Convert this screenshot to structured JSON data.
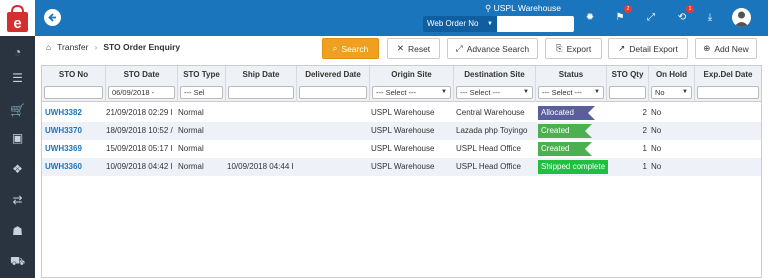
{
  "topbar": {
    "warehouse": "USPL Warehouse",
    "search_mode": "Web Order No",
    "flag_badge": "2",
    "sync_badge": "1"
  },
  "breadcrumb": {
    "parent": "Transfer",
    "current": "STO Order Enquiry"
  },
  "toolbar": {
    "search": "Search",
    "reset": "Reset",
    "advance_search": "Advance Search",
    "export": "Export",
    "detail_export": "Detail Export",
    "add_new": "Add New"
  },
  "columns": [
    "STO No",
    "STO Date",
    "STO Type",
    "Ship Date",
    "Delivered Date",
    "Origin Site",
    "Destination Site",
    "Status",
    "STO Qty",
    "On Hold",
    "Exp.Del Date"
  ],
  "filters": {
    "sto_date": "06/09/2018 -",
    "sto_type": "--- Sel",
    "origin_site": "--- Select ---",
    "destination_site": "--- Select ---",
    "status": "--- Select ---",
    "on_hold": "No"
  },
  "rows": [
    {
      "sto_no": "UWH3382",
      "sto_date": "21/09/2018 02:29 I",
      "sto_type": "Normal",
      "ship_date": "",
      "delivered_date": "",
      "origin": "USPL Warehouse",
      "destination": "Central Warehouse",
      "status": "Allocated",
      "status_color": "#5b5e9c",
      "qty": "2",
      "on_hold": "No"
    },
    {
      "sto_no": "UWH3370",
      "sto_date": "18/09/2018 10:52 /",
      "sto_type": "Normal",
      "ship_date": "",
      "delivered_date": "",
      "origin": "USPL Warehouse",
      "destination": "Lazada php Toyingo",
      "status": "Created",
      "status_color": "#4caf50",
      "qty": "2",
      "on_hold": "No"
    },
    {
      "sto_no": "UWH3369",
      "sto_date": "15/09/2018 05:17 I",
      "sto_type": "Normal",
      "ship_date": "",
      "delivered_date": "",
      "origin": "USPL Warehouse",
      "destination": "USPL Head Office",
      "status": "Created",
      "status_color": "#4caf50",
      "qty": "1",
      "on_hold": "No"
    },
    {
      "sto_no": "UWH3360",
      "sto_date": "10/09/2018 04:42 I",
      "sto_type": "Normal",
      "ship_date": "10/09/2018 04:44 I",
      "delivered_date": "",
      "origin": "USPL Warehouse",
      "destination": "USPL Head Office",
      "status": "Shipped complete",
      "status_color": "#1fbf3f",
      "qty": "1",
      "on_hold": "No"
    }
  ]
}
